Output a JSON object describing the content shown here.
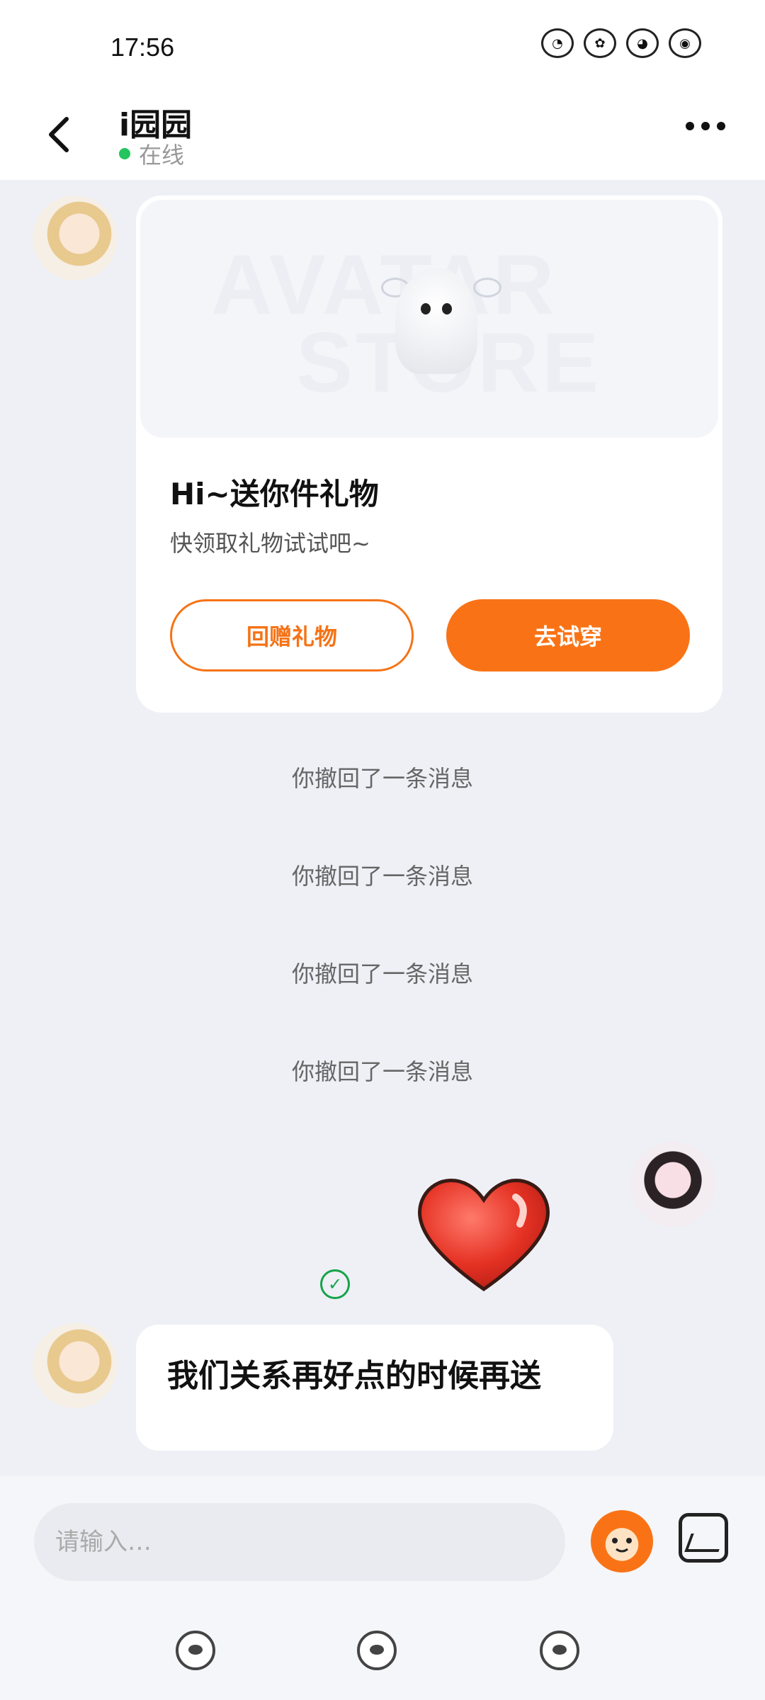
{
  "status_bar": {
    "time": "17:56",
    "icons": [
      "notification-icon-1",
      "notification-icon-2",
      "notification-icon-3",
      "notification-icon-4"
    ]
  },
  "header": {
    "title": "i园园",
    "status": "在线"
  },
  "gift_card": {
    "banner_text_line1": "AVATAR",
    "banner_text_line2": "STORE",
    "title": "Hi~送你件礼物",
    "subtitle": "快领取礼物试试吧~",
    "return_gift_label": "回赠礼物",
    "try_on_label": "去试穿"
  },
  "recalled_messages": [
    "你撤回了一条消息",
    "你撤回了一条消息",
    "你撤回了一条消息",
    "你撤回了一条消息"
  ],
  "peer_message": "我们关系再好点的时候再送",
  "input": {
    "placeholder": "请输入…"
  },
  "colors": {
    "accent": "#f97316",
    "online": "#22c55e",
    "sent": "#16a34a",
    "background": "#eef0f6"
  }
}
